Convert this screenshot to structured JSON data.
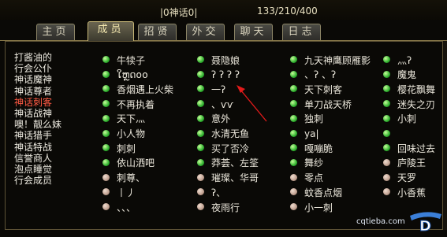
{
  "header": {
    "guild_title": "|0神话0|",
    "member_count": "133/210/400"
  },
  "tabs": [
    {
      "label": "主页",
      "active": false
    },
    {
      "label": "成员",
      "active": true
    },
    {
      "label": "招贤",
      "active": false
    },
    {
      "label": "外交",
      "active": false
    },
    {
      "label": "聊天",
      "active": false
    },
    {
      "label": "日志",
      "active": false
    }
  ],
  "ranks": [
    {
      "label": "打酱油的",
      "active": false
    },
    {
      "label": "行会公仆",
      "active": false
    },
    {
      "label": "神话魔神",
      "active": false
    },
    {
      "label": "神话尊者",
      "active": false
    },
    {
      "label": "神话刺客",
      "active": true
    },
    {
      "label": "神话战神",
      "active": false
    },
    {
      "label": "噢！靓么妹",
      "active": false
    },
    {
      "label": "神话猎手",
      "active": false
    },
    {
      "label": "神话特战",
      "active": false
    },
    {
      "label": "信誉商人",
      "active": false
    },
    {
      "label": "泡点睡觉",
      "active": false
    },
    {
      "label": "行会成员",
      "active": false
    }
  ],
  "members": [
    [
      {
        "name": "牛犊子",
        "online": true
      },
      {
        "name": "ໃຫຼດ໐໐",
        "online": true
      },
      {
        "name": "香烟遇上火柴",
        "online": true
      },
      {
        "name": "不再执着",
        "online": true
      },
      {
        "name": "天下灬",
        "online": true
      },
      {
        "name": "小人物",
        "online": true
      },
      {
        "name": "刺刺",
        "online": true
      },
      {
        "name": "依山洒吧",
        "online": true
      },
      {
        "name": "刺尊、",
        "online": false
      },
      {
        "name": "丨丿",
        "online": false
      },
      {
        "name": "、、、",
        "online": false
      }
    ],
    [
      {
        "name": "聂隐娘",
        "online": true
      },
      {
        "name": "ʔ ʔ ʔ ʔ",
        "online": true
      },
      {
        "name": "一ʔ",
        "online": true
      },
      {
        "name": "、ѵѵ",
        "online": true
      },
      {
        "name": "意外",
        "online": true
      },
      {
        "name": "水清无鱼",
        "online": true
      },
      {
        "name": "买了否冷",
        "online": true
      },
      {
        "name": "莽荟、左筌",
        "online": true
      },
      {
        "name": "璀璨、华哥",
        "online": false
      },
      {
        "name": "ʔ、",
        "online": false
      },
      {
        "name": "夜雨行",
        "online": false
      }
    ],
    [
      {
        "name": "九天神鹰顾雁影",
        "online": true
      },
      {
        "name": "、ʔ 、ʔ",
        "online": true
      },
      {
        "name": "天下刺客",
        "online": true
      },
      {
        "name": "单刀战天桥",
        "online": true
      },
      {
        "name": "独刺",
        "online": true
      },
      {
        "name": "ya|",
        "online": true
      },
      {
        "name": "嘎嘣脆",
        "online": true
      },
      {
        "name": "舞纱",
        "online": true
      },
      {
        "name": "零点",
        "online": false
      },
      {
        "name": "蚊香点烟",
        "online": false
      },
      {
        "name": "小一刺",
        "online": false
      }
    ],
    [
      {
        "name": "灬ʔ",
        "online": true
      },
      {
        "name": "魔鬼",
        "online": true
      },
      {
        "name": "樱花飘舞",
        "online": true
      },
      {
        "name": "迷失之刃",
        "online": true
      },
      {
        "name": "小刺",
        "online": true
      },
      {
        "name": "",
        "online": true
      },
      {
        "name": "回味过去",
        "online": true
      },
      {
        "name": "庐陵王",
        "online": false
      },
      {
        "name": "天罗",
        "online": false
      },
      {
        "name": "小香蕉",
        "online": false
      }
    ]
  ],
  "watermark": {
    "site": "cqtieba.com",
    "logo_text": "D"
  },
  "colors": {
    "online_dot": "#2fb12f",
    "offline_dot": "#c0a090",
    "active_rank": "#ff5a44",
    "annotation": "#e21a1a"
  }
}
